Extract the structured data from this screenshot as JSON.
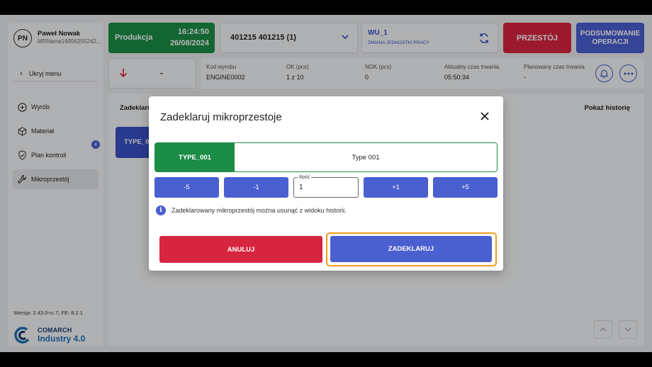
{
  "user": {
    "initials": "PN",
    "name": "Paweł Nowak",
    "id": "MRName16956255242..."
  },
  "sidebar": {
    "collapse_label": "Ukryj menu",
    "items": [
      {
        "label": "Wyrób",
        "icon": "plus-circle-icon"
      },
      {
        "label": "Materiał",
        "icon": "box-icon"
      },
      {
        "label": "Plan kontroli",
        "icon": "shield-check-icon",
        "badge": "4"
      },
      {
        "label": "Mikroprzestój",
        "icon": "wrench-icon",
        "active": true
      }
    ],
    "version": "Wersja: 2.43.0-rc.7; FE: 8.2.1",
    "logo_line1": "COMARCH",
    "logo_line2": "Industry 4.0"
  },
  "header": {
    "status": "Produkcja",
    "time": "16:24:50",
    "date": "26/08/2024",
    "order": "401215 401215  (1)",
    "wu_name": "WU_1",
    "wu_sub": "ZMIANA JEDNOSTKI PRACY",
    "przestoj": "PRZESTÓJ",
    "podsumowanie": "PODSUMOWANIE OPERACJI"
  },
  "info": {
    "arrow_value": "-",
    "kod_label": "Kod wyrobu",
    "kod_value": "ENGINE0002",
    "ok_label": "OK (pcs)",
    "ok_value": "1 z 10",
    "nok_label": "NOK (pcs)",
    "nok_value": "0",
    "akt_label": "Aktualny czas trwania",
    "akt_value": "05:50:34",
    "plan_label": "Planowany czas trwania",
    "plan_value": "-"
  },
  "content": {
    "section_label": "Zadeklaruj",
    "history_label": "Pokaż historię",
    "tile_label": "TYPE_001"
  },
  "modal": {
    "title": "Zadeklaruj mikroprzestoje",
    "type_code": "TYPE_001",
    "type_name": "Type 001",
    "steps": [
      "-5",
      "-1",
      "+1",
      "+5"
    ],
    "qty_label": "Ilość",
    "qty_value": "1",
    "note": "Zadeklarowany mikroprzestój można usunąć z widoku historii.",
    "cancel": "ANULUJ",
    "confirm": "ZADEKLARUJ"
  },
  "colors": {
    "green": "#1b8c45",
    "red": "#d8253f",
    "blue": "#4a5fd0",
    "highlight": "#f39c1f"
  }
}
